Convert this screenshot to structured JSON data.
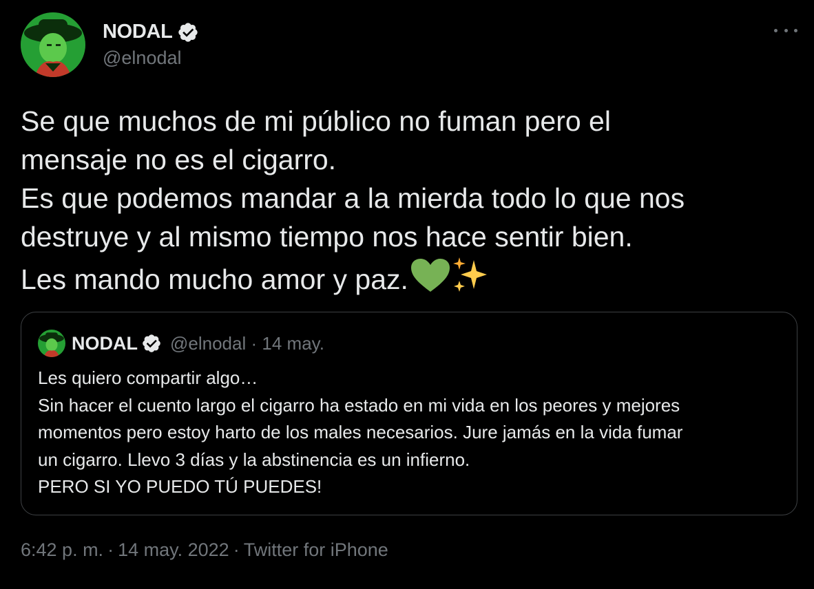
{
  "author": {
    "display_name": "NODAL",
    "handle": "@elnodal",
    "verified": true
  },
  "tweet": {
    "text": "Se que muchos de mi público no fuman pero el\nmensaje no es el cigarro.\nEs que podemos mandar a la mierda todo lo que nos\ndestruye y al mismo tiempo nos hace sentir bien.\nLes mando mucho amor y paz.",
    "emojis": [
      "green-heart",
      "sparkles"
    ]
  },
  "quoted": {
    "display_name": "NODAL",
    "handle": "@elnodal",
    "separator": "·",
    "date": "14 may.",
    "text": "Les quiero compartir algo…\nSin hacer el cuento largo el cigarro ha estado en mi vida en los peores y mejores\nmomentos pero estoy harto de los males necesarios. Jure jamás en la vida fumar\nun cigarro. Llevo 3 días y la abstinencia es un infierno.\nPERO SI YO PUEDO TÚ PUEDES!"
  },
  "footer": {
    "time": "6:42 p. m.",
    "separator": "·",
    "date": "14 may. 2022",
    "source": "Twitter for iPhone"
  },
  "icons": {
    "more": "more-options-icon",
    "verified": "verified-badge-icon"
  },
  "colors": {
    "background": "#000000",
    "primary_text": "#e7e9ea",
    "secondary_text": "#71767b",
    "border": "#3e4144",
    "avatar_green": "#2fd84a"
  }
}
